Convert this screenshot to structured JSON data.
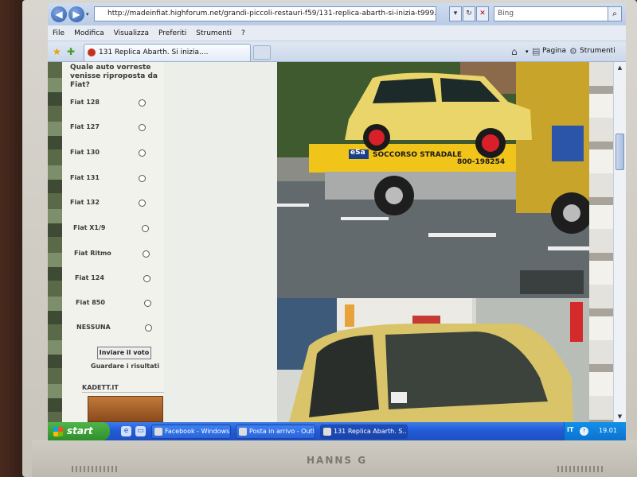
{
  "browser": {
    "url": "http://madeinfiat.highforum.net/grandi-piccoli-restauri-f59/131-replica-abarth-si-inizia-t999.htm#17423",
    "search_placeholder": "Bing",
    "menu": [
      "File",
      "Modifica",
      "Visualizza",
      "Preferiti",
      "Strumenti",
      "?"
    ],
    "active_tab": "131 Replica Abarth. Si inizia....",
    "commands": {
      "page": "Pagina",
      "tools": "Strumenti"
    },
    "icons": {
      "back": "back-arrow-icon",
      "forward": "forward-arrow-icon",
      "refresh": "refresh-icon",
      "stop": "stop-icon",
      "search": "search-icon",
      "home": "home-icon",
      "favorites": "favorites-star-icon"
    }
  },
  "poll": {
    "question": "Quale auto vorreste venisse riproposta da Fiat?",
    "options": [
      "Fiat 128",
      "Fiat 127",
      "Fiat 130",
      "Fiat 131",
      "Fiat 132",
      "Fiat X1/9",
      "Fiat Ritmo",
      "Fiat 124",
      "Fiat 850",
      "NESSUNA"
    ],
    "vote_button": "Inviare il voto",
    "results_link": "Guardare i risultati"
  },
  "sidebar": {
    "kadett_label": "KADETT.IT"
  },
  "photos": {
    "truck_text": "SOCCORSO STRADALE",
    "truck_phone": "800-198254",
    "truck_logo": "eSa"
  },
  "taskbar": {
    "start": "start",
    "tasks": [
      "Facebook - Windows ...",
      "Posta in arrivo - Outl...",
      "131 Replica Abarth. S..."
    ],
    "language": "IT",
    "clock": "19.01"
  },
  "monitor": {
    "brand": "HANNS G"
  },
  "colors": {
    "car_yellow": "#e9d56a",
    "truck_yellow": "#f0c419",
    "taskbar_blue": "#245edb",
    "start_green": "#3a9e36"
  }
}
